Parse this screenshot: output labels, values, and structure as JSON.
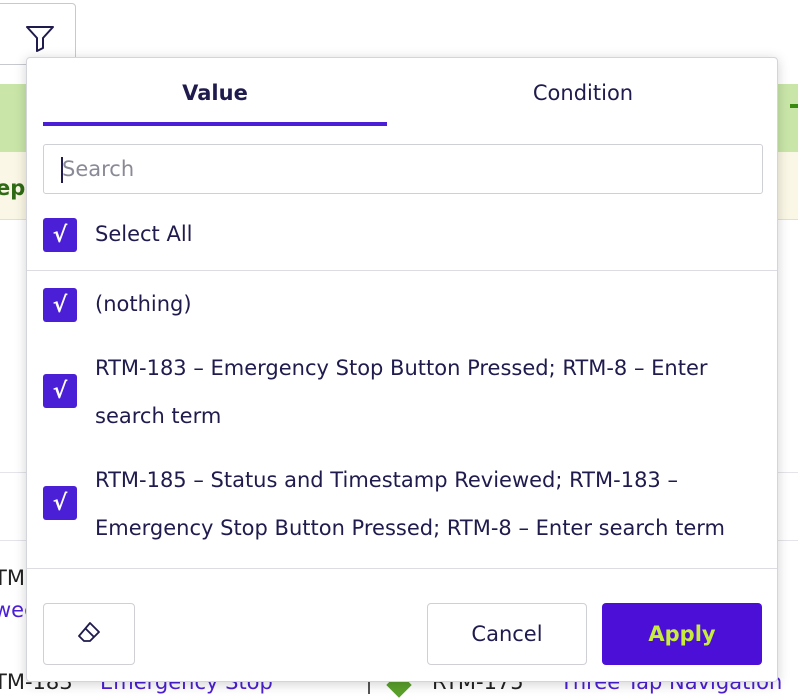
{
  "background": {
    "header_left_text": "ep",
    "row_left_text": "TM-",
    "row_left_link": "wed",
    "bottom_left_text": "TM-183",
    "bottom_mid_link": "Emergency Stop",
    "bottom_right_text": "RTM-175",
    "bottom_right_link": "Three Tap Navigation"
  },
  "filter_panel": {
    "tabs": [
      {
        "label": "Value",
        "active": true
      },
      {
        "label": "Condition",
        "active": false
      }
    ],
    "search": {
      "placeholder": "Search",
      "value": ""
    },
    "select_all": {
      "label": "Select All",
      "checked": true,
      "check_glyph": "√"
    },
    "options": [
      {
        "label": "(nothing)",
        "checked": true
      },
      {
        "label_line1": "RTM-183 – Emergency Stop Button Pressed; RTM-8 – Enter",
        "label_line2": "search term",
        "checked": true
      },
      {
        "label_line1": "RTM-185 – Status and Timestamp Reviewed; RTM-183 –",
        "label_line2": "Emergency Stop Button Pressed; RTM-8 – Enter search term",
        "checked": true
      }
    ],
    "buttons": {
      "clear_icon": "eraser-icon",
      "cancel": "Cancel",
      "apply": "Apply"
    }
  },
  "colors": {
    "accent": "#4b1fd6",
    "apply_text": "#c8ec3c",
    "header_green": "#c9e6a8"
  }
}
